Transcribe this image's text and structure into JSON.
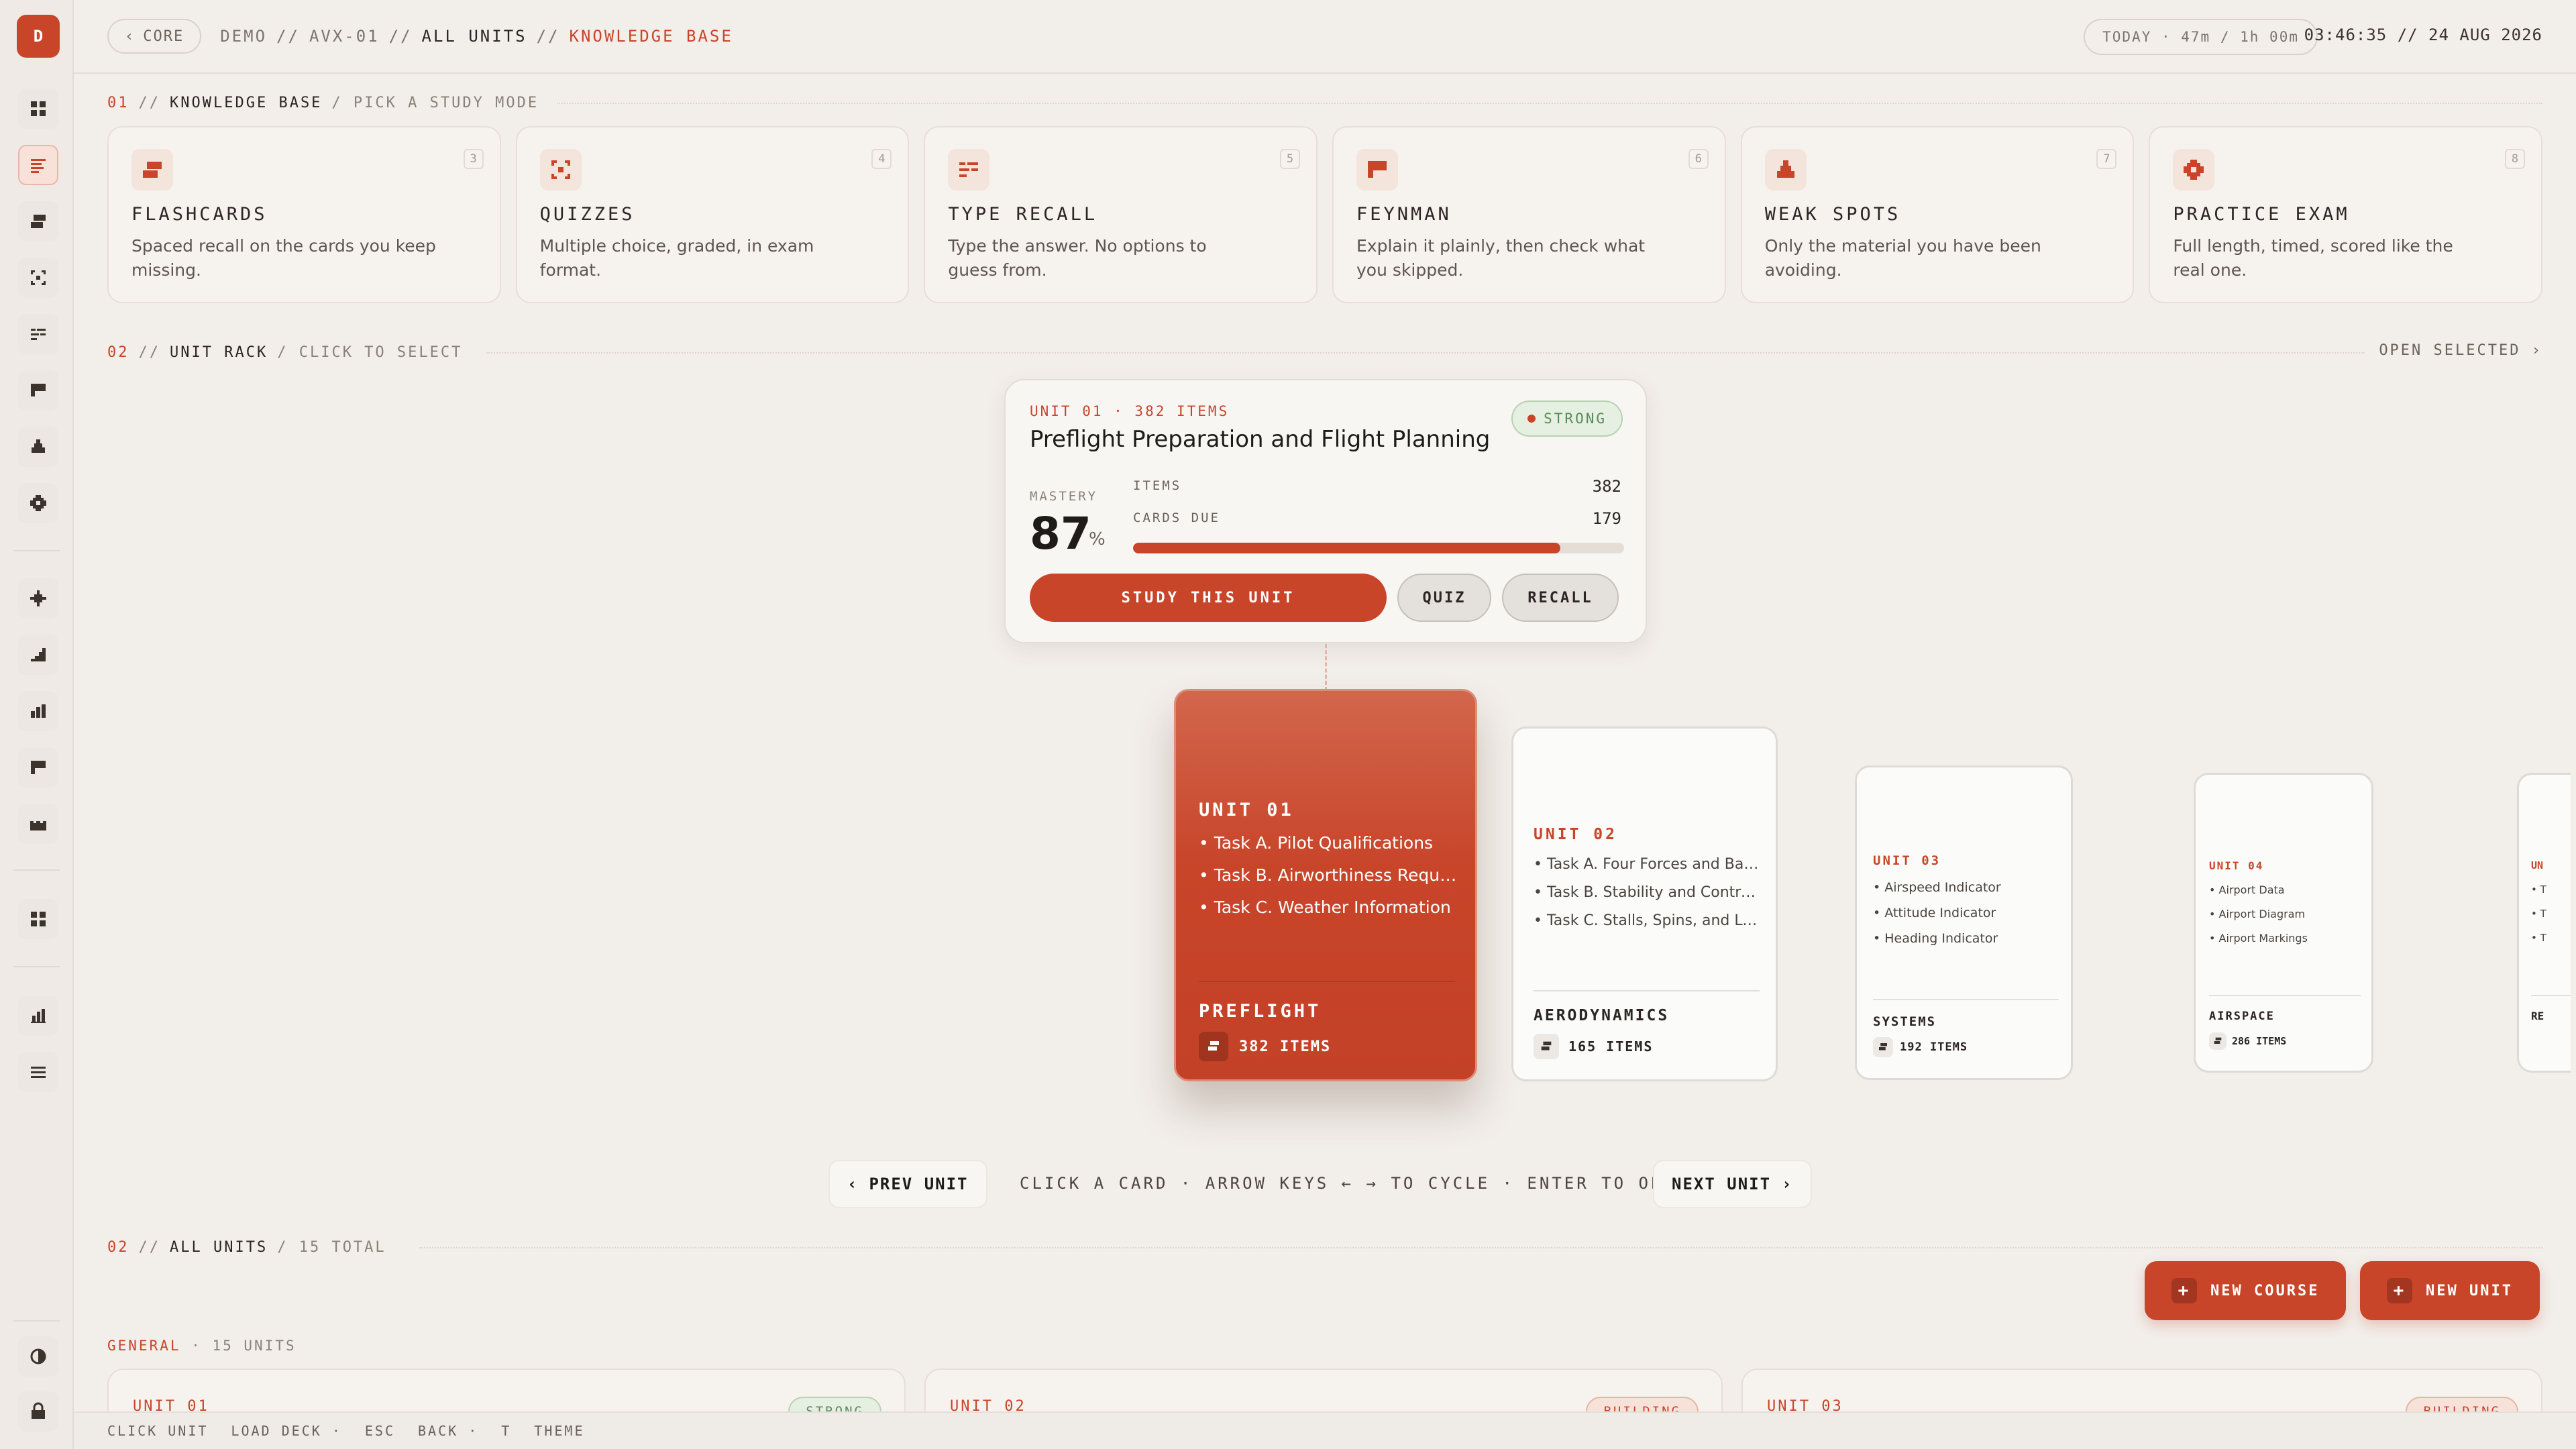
{
  "app": {
    "logo_letter": "D",
    "accent": "#c8452a"
  },
  "topbar": {
    "back_label": "CORE",
    "crumbs": [
      "DEMO",
      "//",
      "AVX-01",
      "//",
      "ALL UNITS",
      "//",
      "KNOWLEDGE BASE"
    ],
    "today": "TODAY · 47m / 1h 00m",
    "clock": "03:46:35 // 24 AUG 2026"
  },
  "sidebar": {
    "icons": [
      "grid-icon",
      "list-icon",
      "flashcards-icon",
      "quiz-icon",
      "recall-icon",
      "feynman-icon",
      "weak-spots-icon",
      "exam-icon",
      "sparkle-icon",
      "chart-icon",
      "bar-chart-icon",
      "flag-icon",
      "timeline-icon",
      "grid-icon",
      "stats-icon",
      "menu-icon",
      "theme-icon",
      "lock-icon"
    ]
  },
  "section1": {
    "num": "01",
    "sep": "//",
    "title": "KNOWLEDGE BASE",
    "sub": "/ PICK A STUDY MODE"
  },
  "modes": [
    {
      "key": "3",
      "title": "FLASHCARDS",
      "desc": "Spaced recall on the cards you keep missing.",
      "icon": "flashcards-icon"
    },
    {
      "key": "4",
      "title": "QUIZZES",
      "desc": "Multiple choice, graded, in exam format.",
      "icon": "quiz-icon"
    },
    {
      "key": "5",
      "title": "TYPE RECALL",
      "desc": "Type the answer. No options to guess from.",
      "icon": "recall-icon"
    },
    {
      "key": "6",
      "title": "FEYNMAN",
      "desc": "Explain it plainly, then check what you skipped.",
      "icon": "feynman-icon"
    },
    {
      "key": "7",
      "title": "WEAK SPOTS",
      "desc": "Only the material you have been avoiding.",
      "icon": "weak-spots-icon"
    },
    {
      "key": "8",
      "title": "PRACTICE EXAM",
      "desc": "Full length, timed, scored like the real one.",
      "icon": "exam-icon"
    }
  ],
  "section2": {
    "num": "02",
    "sep": "//",
    "title": "UNIT RACK",
    "sub": "/ CLICK TO SELECT",
    "open_selected": "OPEN SELECTED ›"
  },
  "detail": {
    "meta": "UNIT 01 · 382 ITEMS",
    "title": "Preflight Preparation and Flight Planning",
    "badge": "STRONG",
    "mastery_label": "MASTERY",
    "mastery_value": "87",
    "mastery_unit": "%",
    "mastery_fraction": 0.87,
    "items_label": "ITEMS",
    "items_value": "382",
    "due_label": "CARDS DUE",
    "due_value": "179",
    "study_button": "STUDY THIS UNIT",
    "quiz_button": "QUIZ",
    "recall_button": "RECALL"
  },
  "rack": [
    {
      "unit": "UNIT 01",
      "tasks": [
        "• Task A. Pilot Qualifications",
        "• Task B. Airworthiness Requirements",
        "• Task C. Weather Information"
      ],
      "name": "PREFLIGHT",
      "items": "382 ITEMS"
    },
    {
      "unit": "UNIT 02",
      "tasks": [
        "• Task A. Four Forces and Basic Aerodynamics",
        "• Task B. Stability and Controllability",
        "• Task C. Stalls, Spins, and Load Factors"
      ],
      "name": "AERODYNAMICS",
      "items": "165 ITEMS"
    },
    {
      "unit": "UNIT 03",
      "tasks": [
        "• Airspeed Indicator",
        "• Attitude Indicator",
        "• Heading Indicator"
      ],
      "name": "SYSTEMS",
      "items": "192 ITEMS"
    },
    {
      "unit": "UNIT 04",
      "tasks": [
        "• Airport Data",
        "• Airport Diagram",
        "• Airport Markings"
      ],
      "name": "AIRSPACE",
      "items": "286 ITEMS"
    },
    {
      "unit": "UN",
      "tasks": [
        "• T",
        "• T",
        "• T"
      ],
      "name": "RE",
      "items": ""
    }
  ],
  "rack_nav": {
    "prev": "PREV UNIT",
    "next": "NEXT UNIT",
    "hint": "CLICK A CARD · ARROW KEYS ← → TO CYCLE · ENTER TO OPEN"
  },
  "section3": {
    "num": "02",
    "sep": "//",
    "title": "ALL UNITS",
    "sub": "/ 15 TOTAL"
  },
  "actions": {
    "new_course": "NEW COURSE",
    "new_unit": "NEW UNIT",
    "plus": "+"
  },
  "general": {
    "label": "GENERAL",
    "count": "· 15 UNITS"
  },
  "unit_list": [
    {
      "unit": "UNIT 01",
      "badge": "STRONG"
    },
    {
      "unit": "UNIT 02",
      "badge": "BUILDING"
    },
    {
      "unit": "UNIT 03",
      "badge": "BUILDING"
    }
  ],
  "footer": [
    "CLICK UNIT",
    "LOAD DECK ·",
    "ESC",
    "BACK ·",
    "T",
    "THEME"
  ]
}
